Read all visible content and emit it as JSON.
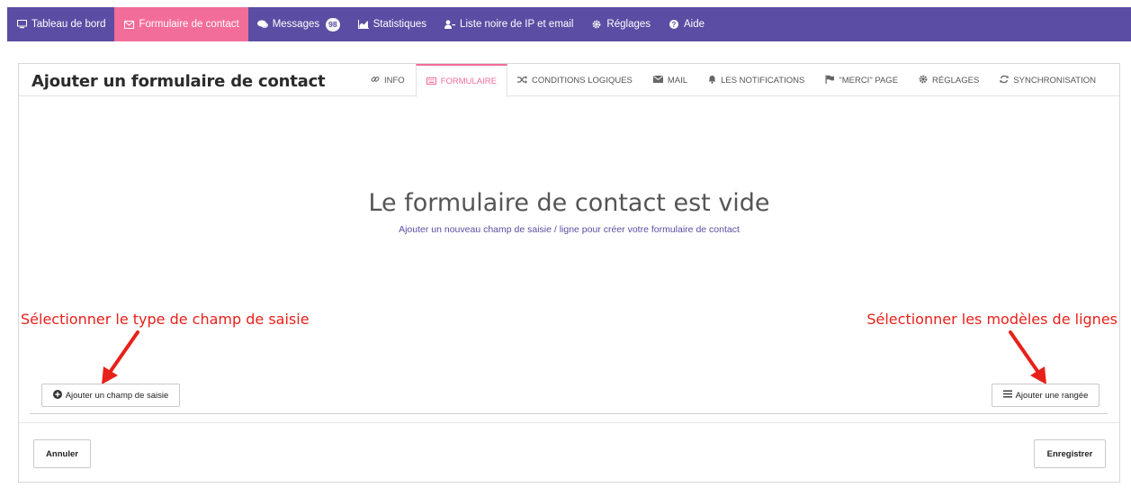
{
  "nav": {
    "items": [
      {
        "label": "Tableau de bord",
        "icon": "monitor-icon"
      },
      {
        "label": "Formulaire de contact",
        "icon": "envelope-icon"
      },
      {
        "label": "Messages",
        "icon": "comments-icon",
        "badge": "98"
      },
      {
        "label": "Statistiques",
        "icon": "area-chart-icon"
      },
      {
        "label": "Liste noire de IP et email",
        "icon": "users-block-icon"
      },
      {
        "label": "Réglages",
        "icon": "gear-icon"
      },
      {
        "label": "Aide",
        "icon": "question-icon"
      }
    ],
    "colors": {
      "bar": "#5b4da3",
      "active": "#f36d9a"
    }
  },
  "header": {
    "title": "Ajouter un formulaire de contact",
    "tabs": [
      {
        "label": "INFO",
        "icon": "link-icon"
      },
      {
        "label": "FORMULAIRE",
        "icon": "keyboard-icon",
        "active": true
      },
      {
        "label": "CONDITIONS LOGIQUES",
        "icon": "random-icon"
      },
      {
        "label": "MAIL",
        "icon": "mail-icon"
      },
      {
        "label": "LES NOTIFICATIONS",
        "icon": "bell-icon"
      },
      {
        "label": "\"MERCI\" PAGE",
        "icon": "flag-icon"
      },
      {
        "label": "RÉGLAGES",
        "icon": "gear-icon"
      },
      {
        "label": "SYNCHRONISATION",
        "icon": "sync-icon"
      }
    ]
  },
  "empty_state": {
    "title": "Le formulaire de contact est vide",
    "subtitle": "Ajouter un nouveau champ de saisie / ligne pour créer votre formulaire de contact"
  },
  "annotations": {
    "left": "Sélectionner le type de champ de saisie",
    "right": "Sélectionner les modèles de lignes"
  },
  "buttons": {
    "add_field": "Ajouter un champ de saisie",
    "add_row": "Ajouter une rangée",
    "cancel": "Annuler",
    "save": "Enregistrer"
  }
}
